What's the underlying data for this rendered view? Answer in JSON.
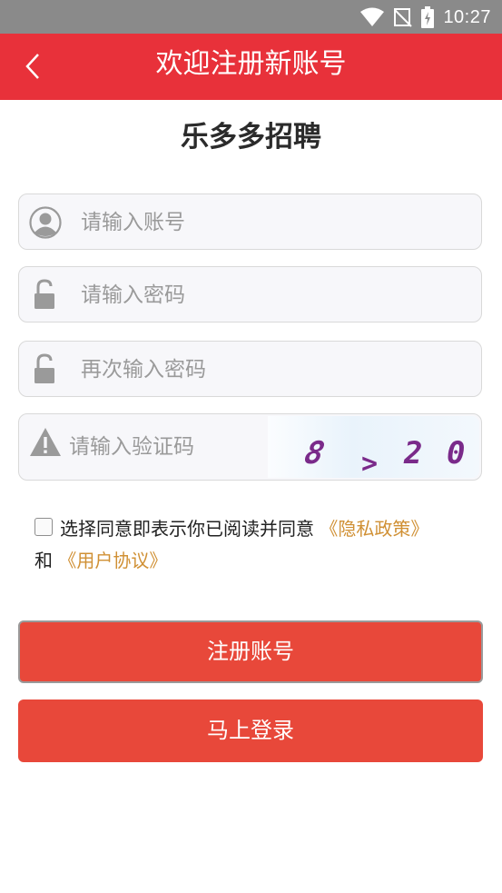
{
  "status": {
    "time": "10:27"
  },
  "header": {
    "title": "欢迎注册新账号"
  },
  "brand": {
    "name": "乐多多招聘"
  },
  "form": {
    "account_placeholder": "请输入账号",
    "password_placeholder": "请输入密码",
    "confirm_placeholder": "再次输入密码",
    "captcha_placeholder": "请输入验证码",
    "captcha_code": [
      "8",
      ">",
      "2",
      "0"
    ]
  },
  "agreement": {
    "text": "选择同意即表示你已阅读并同意",
    "privacy_link": "《隐私政策》",
    "and": "和",
    "user_link": "《用户协议》",
    "checked": false
  },
  "buttons": {
    "register": "注册账号",
    "login": "马上登录"
  },
  "colors": {
    "primary": "#e8313a",
    "button": "#e8483a",
    "link": "#d09034",
    "captcha": "#7a2a8a"
  }
}
